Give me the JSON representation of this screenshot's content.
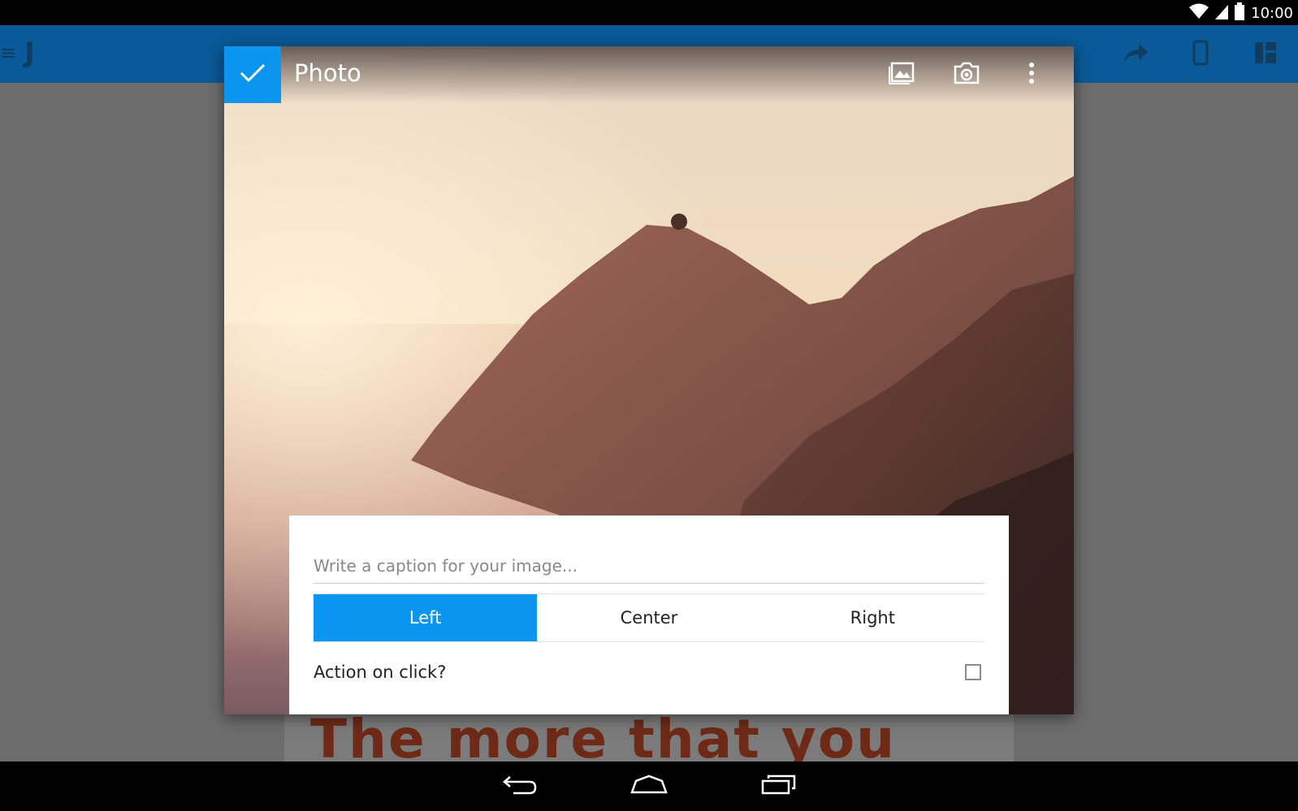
{
  "status_bar": {
    "time": "10:00",
    "icons": [
      "wifi-icon",
      "signal-icon",
      "battery-icon"
    ]
  },
  "app": {
    "logo_text": "J",
    "toolbar_icons": [
      "share-icon",
      "phone-preview-icon",
      "layout-icon"
    ]
  },
  "dialog": {
    "title": "Photo",
    "header_icons": [
      "confirm-check-icon",
      "gallery-icon",
      "camera-icon",
      "more-vert-icon"
    ],
    "caption": {
      "value": "",
      "placeholder": "Write a caption for your image..."
    },
    "alignment": {
      "options": [
        "Left",
        "Center",
        "Right"
      ],
      "selected": "Left"
    },
    "action_on_click": {
      "label": "Action on click?",
      "checked": false
    }
  },
  "document": {
    "heading": "The more that you"
  },
  "colors": {
    "accent": "#0a96f0",
    "toolbar": "#0a5a99",
    "heading": "#6e2a17",
    "overlay": "#6d6d6d"
  },
  "nav_bar": {
    "buttons": [
      "back-icon",
      "home-icon",
      "recents-icon"
    ]
  }
}
